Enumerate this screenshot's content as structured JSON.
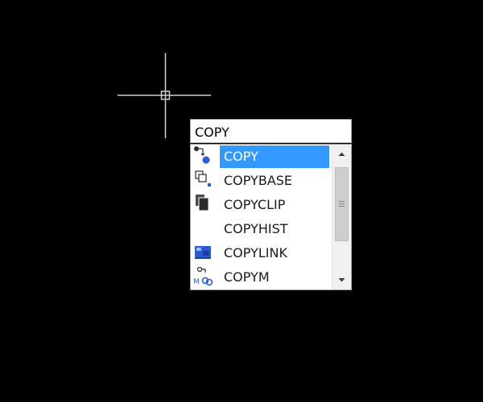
{
  "command_line": {
    "value": "COPY"
  },
  "autocomplete": {
    "selected_index": 0,
    "items": [
      {
        "label": "COPY",
        "icon": "copy-icon"
      },
      {
        "label": "COPYBASE",
        "icon": "copybase-icon"
      },
      {
        "label": "COPYCLIP",
        "icon": "copyclip-icon"
      },
      {
        "label": "COPYHIST",
        "icon": ""
      },
      {
        "label": "COPYLINK",
        "icon": "copylink-icon"
      },
      {
        "label": "COPYM",
        "icon": "copym-icon"
      }
    ]
  },
  "colors": {
    "background": "#000000",
    "selection": "#3399ff",
    "crosshair": "#d0d0d0",
    "icon_blue": "#2a5bd7"
  }
}
